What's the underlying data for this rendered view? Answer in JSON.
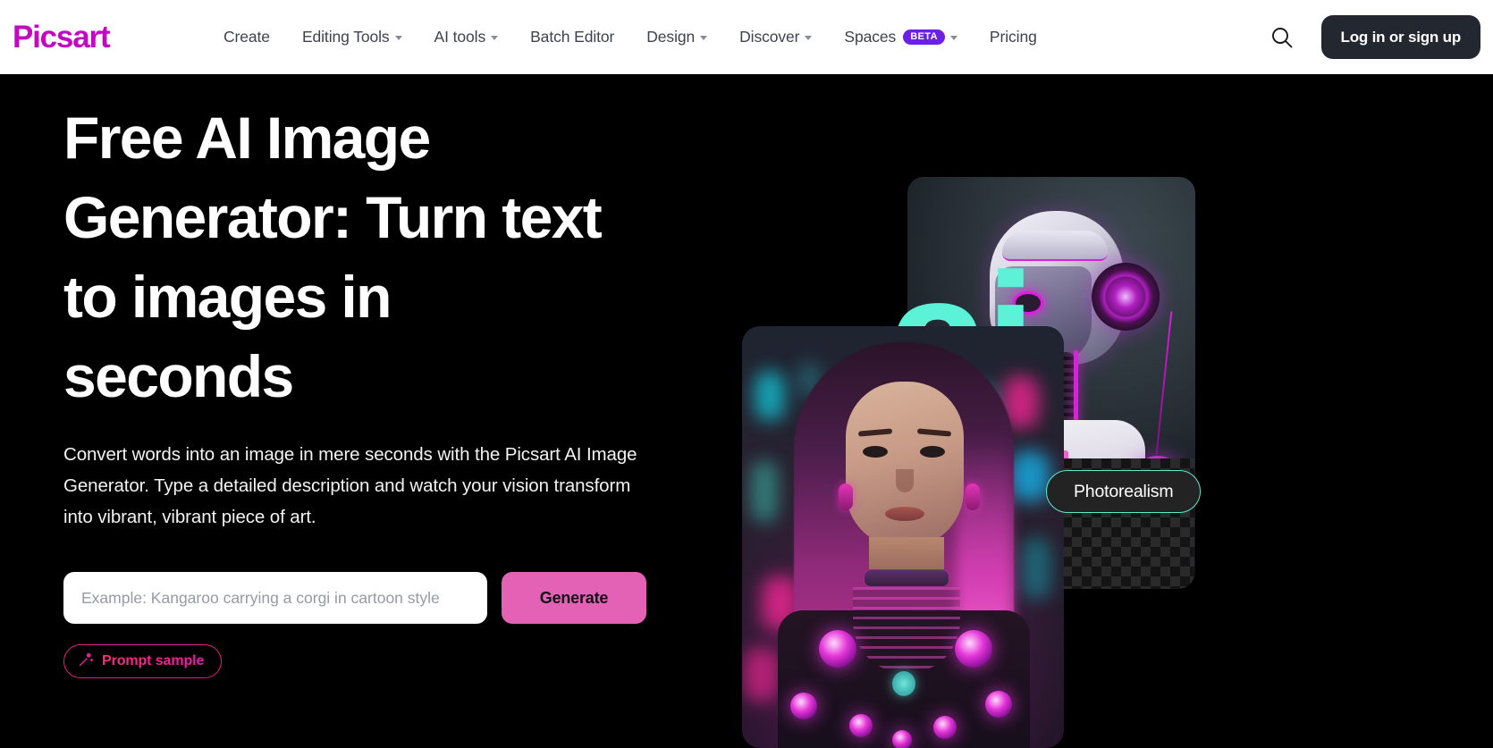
{
  "header": {
    "logo_text": "Picsart",
    "logo_color": "#C209C1",
    "nav_items": [
      {
        "label": "Create",
        "has_caret": false,
        "badge": null
      },
      {
        "label": "Editing Tools",
        "has_caret": true,
        "badge": null
      },
      {
        "label": "AI tools",
        "has_caret": true,
        "badge": null
      },
      {
        "label": "Batch Editor",
        "has_caret": false,
        "badge": null
      },
      {
        "label": "Design",
        "has_caret": true,
        "badge": null
      },
      {
        "label": "Discover",
        "has_caret": true,
        "badge": null
      },
      {
        "label": "Spaces",
        "has_caret": true,
        "badge": "BETA"
      },
      {
        "label": "Pricing",
        "has_caret": false,
        "badge": null
      }
    ],
    "search_icon": "search-icon",
    "login_label": "Log in or sign up",
    "login_bg": "#23272F",
    "beta_badge_bg": "#6C1FE8"
  },
  "hero": {
    "headline": "Free AI Image Generator: Turn text to images in seconds",
    "subtext": "Convert words into an image in mere seconds with the Picsart AI Image Generator. Type a detailed description and watch your vision transform into vibrant, vibrant piece of art.",
    "prompt_placeholder": "Example: Kangaroo carrying a corgi in cartoon style",
    "prompt_value": "",
    "generate_label": "Generate",
    "generate_bg": "#E462B5",
    "prompt_sample_label": "Prompt sample",
    "prompt_sample_icon": "magic-wand-icon",
    "prompt_sample_border": "#E0218A",
    "background": "#000000"
  },
  "art": {
    "ai_word": "ai",
    "ai_word_color": "#5BF2D7",
    "photorealism_label": "Photorealism",
    "photorealism_border": "#5BE9D0",
    "photorealism_bg": "#232323"
  }
}
